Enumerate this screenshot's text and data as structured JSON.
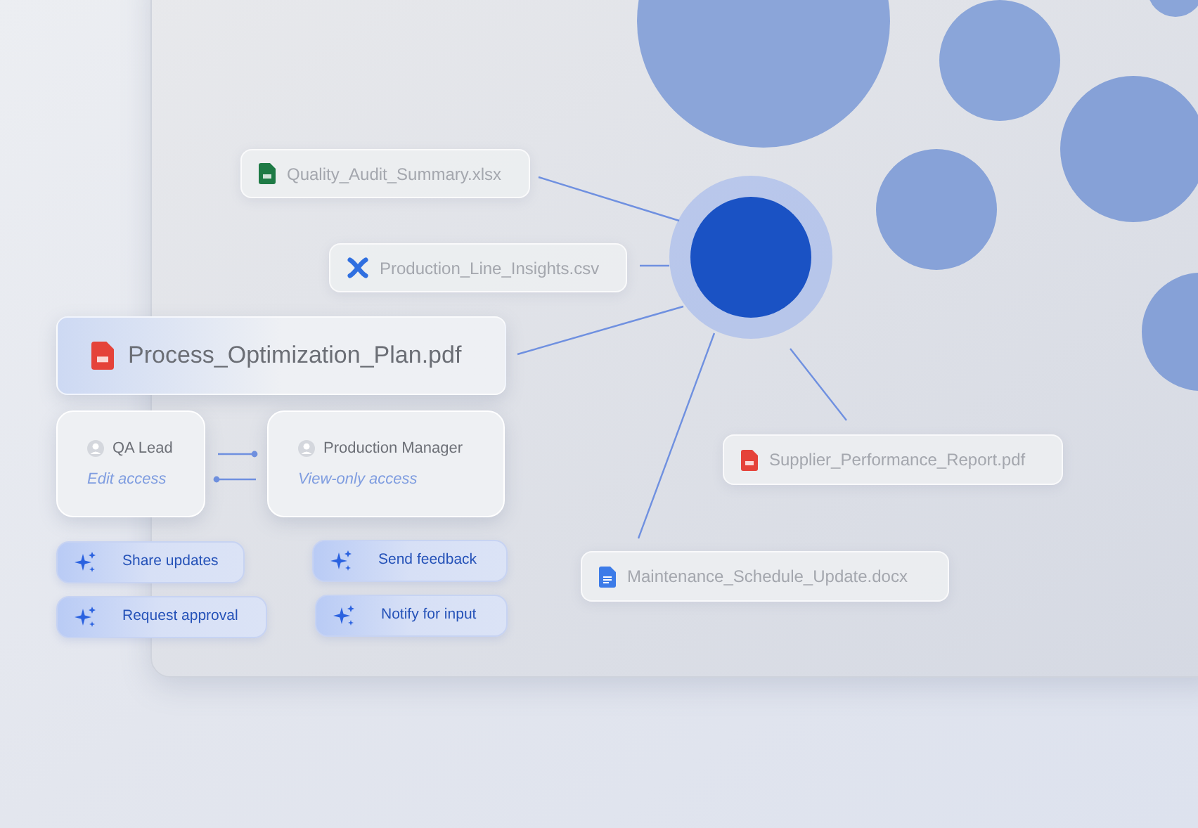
{
  "files": [
    {
      "kind": "xlsx",
      "name": "Quality_Audit_Summary.xlsx",
      "emphasis": false
    },
    {
      "kind": "csv",
      "name": "Production_Line_Insights.csv",
      "emphasis": false
    },
    {
      "kind": "pdf",
      "name": "Process_Optimization_Plan.pdf",
      "emphasis": true
    },
    {
      "kind": "pdf",
      "name": "Supplier_Performance_Report.pdf",
      "emphasis": false
    },
    {
      "kind": "docx",
      "name": "Maintenance_Schedule_Update.docx",
      "emphasis": false
    }
  ],
  "people": [
    {
      "name": "QA Lead",
      "access": "Edit access"
    },
    {
      "name": "Production Manager",
      "access": "View-only access"
    }
  ],
  "actions": [
    "Share updates",
    "Request approval",
    "Send feedback",
    "Notify for input"
  ]
}
